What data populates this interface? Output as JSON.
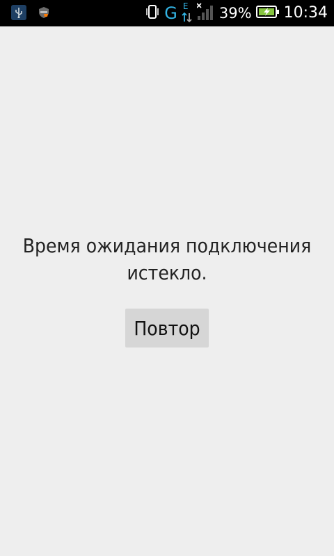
{
  "status_bar": {
    "left_icons": [
      "usb-icon",
      "shield-icon"
    ],
    "network_type": "G",
    "network_sub": "E",
    "battery_percent": "39%",
    "time": "10:34"
  },
  "main": {
    "message": "Время ожидания подключения истекло.",
    "retry_label": "Повтор"
  },
  "colors": {
    "background": "#eeeeee",
    "status_bar": "#000000",
    "button": "#d6d6d6",
    "network_accent": "#33b5e5",
    "battery_fill": "#86c440"
  }
}
